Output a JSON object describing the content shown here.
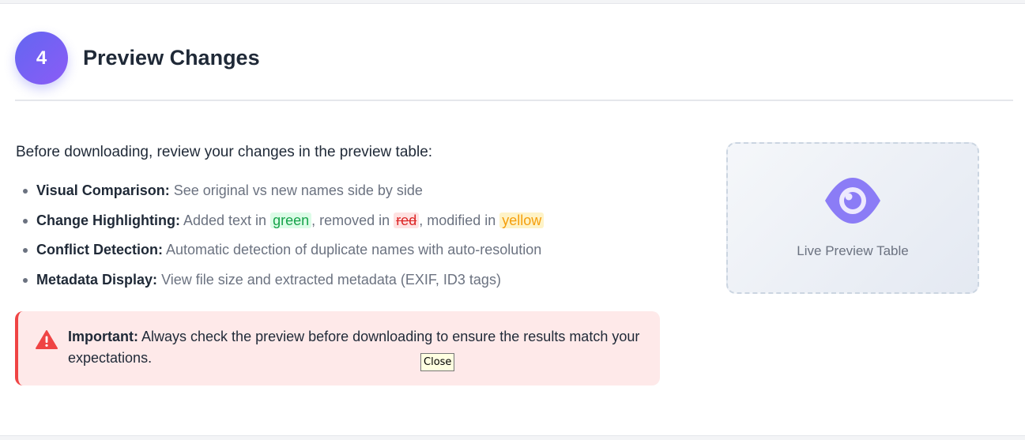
{
  "step": {
    "number": "4",
    "title": "Preview Changes"
  },
  "intro": "Before downloading, review your changes in the preview table:",
  "features": [
    {
      "label": "Visual Comparison:",
      "text": "See original vs new names side by side"
    },
    {
      "label": "Change Highlighting:",
      "text_before": "Added text in",
      "green": "green",
      "text_mid": ", removed in",
      "red": "red",
      "text_mid2": ", modified in",
      "yellow": "yellow"
    },
    {
      "label": "Conflict Detection:",
      "text": "Automatic detection of duplicate names with auto-resolution"
    },
    {
      "label": "Metadata Display:",
      "text": "View file size and extracted metadata (EXIF, ID3 tags)"
    }
  ],
  "alert": {
    "icon": "warning-icon",
    "label": "Important:",
    "text": "Always check the preview before downloading to ensure the results match your expectations."
  },
  "tooltip": "Close",
  "preview": {
    "icon": "eye-icon",
    "label": "Live Preview Table"
  },
  "colors": {
    "accent": "#6366f1",
    "accent_secondary": "#8b5cf6",
    "alert_bg": "#fee9e9",
    "alert_border": "#ef4444",
    "green": "#16a34a",
    "red": "#dc2626",
    "yellow": "#f59e0b"
  }
}
